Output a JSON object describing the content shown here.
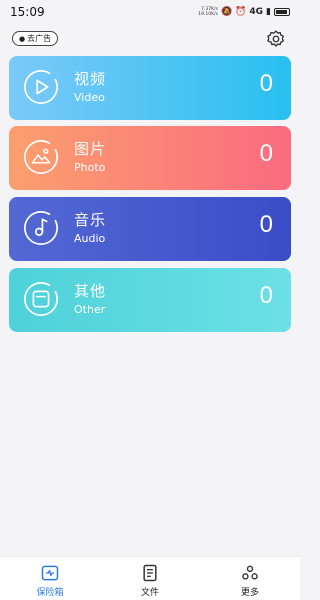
{
  "status_bar": {
    "time": "15:09",
    "speed_up": "7.37K/s",
    "speed_down": "19.10K/s",
    "network": "4G"
  },
  "header": {
    "ad_button_label": "去广告",
    "person_icon": "person-icon",
    "settings_icon": "gear-icon"
  },
  "categories": [
    {
      "cn": "视频",
      "en": "Video",
      "count": "0",
      "icon": "play-circle-icon"
    },
    {
      "cn": "图片",
      "en": "Photo",
      "count": "0",
      "icon": "image-icon"
    },
    {
      "cn": "音乐",
      "en": "Audio",
      "count": "0",
      "icon": "music-note-icon"
    },
    {
      "cn": "其他",
      "en": "Other",
      "count": "0",
      "icon": "folder-icon"
    }
  ],
  "bottom_nav": [
    {
      "label": "保险箱",
      "icon": "vault-icon",
      "active": true
    },
    {
      "label": "文件",
      "icon": "document-icon",
      "active": false
    },
    {
      "label": "更多",
      "icon": "more-icon",
      "active": false
    }
  ],
  "colors": {
    "active_tab": "#2d7be0",
    "video": "#28c0f0",
    "photo": "#fb6b80",
    "audio": "#3a4dc8",
    "other": "#4fd1d9"
  }
}
